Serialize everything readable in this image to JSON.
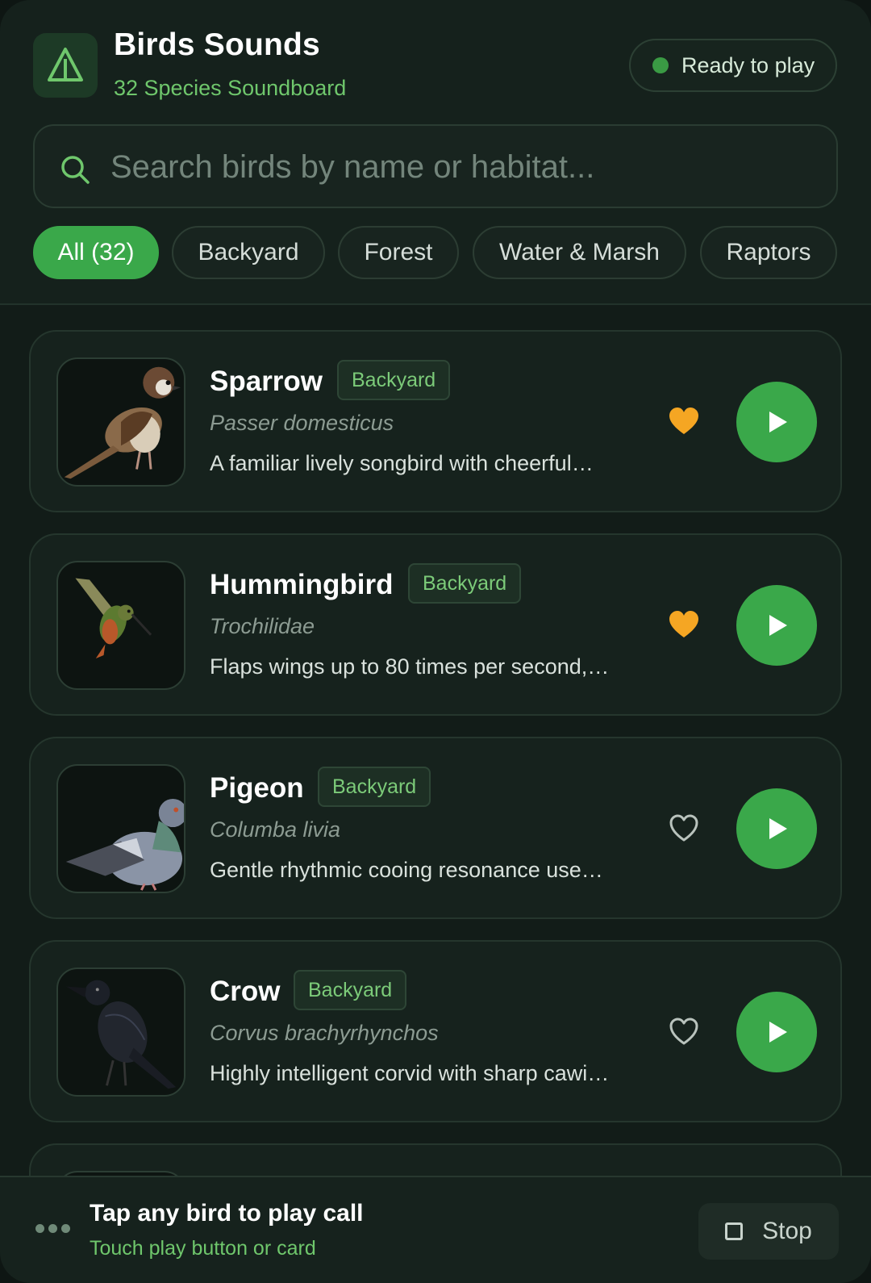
{
  "header": {
    "title": "Birds Sounds",
    "subtitle": "32 Species Soundboard",
    "status": "Ready to play",
    "logo_icon": "mountain-triangle-icon"
  },
  "search": {
    "placeholder": "Search birds by name or habitat..."
  },
  "filters": [
    "All (32)",
    "Backyard",
    "Forest",
    "Water & Marsh",
    "Raptors"
  ],
  "active_filter": "All (32)",
  "colors": {
    "accent": "#3aa84a",
    "favorite": "#f5a623",
    "background": "#121c18"
  },
  "birds": [
    {
      "name": "Sparrow",
      "tag": "Backyard",
      "scientific": "Passer domesticus",
      "description": "A familiar lively songbird with cheerful…",
      "favorite": true
    },
    {
      "name": "Hummingbird",
      "tag": "Backyard",
      "scientific": "Trochilidae",
      "description": "Flaps wings up to 80 times per second,…",
      "favorite": true
    },
    {
      "name": "Pigeon",
      "tag": "Backyard",
      "scientific": "Columba livia",
      "description": "Gentle rhythmic cooing resonance use…",
      "favorite": false
    },
    {
      "name": "Crow",
      "tag": "Backyard",
      "scientific": "Corvus brachyrhynchos",
      "description": "Highly intelligent corvid with sharp cawi…",
      "favorite": false
    }
  ],
  "bottom_bar": {
    "title": "Tap any bird to play call",
    "subtitle": "Touch play button or card",
    "stop_label": "Stop"
  }
}
